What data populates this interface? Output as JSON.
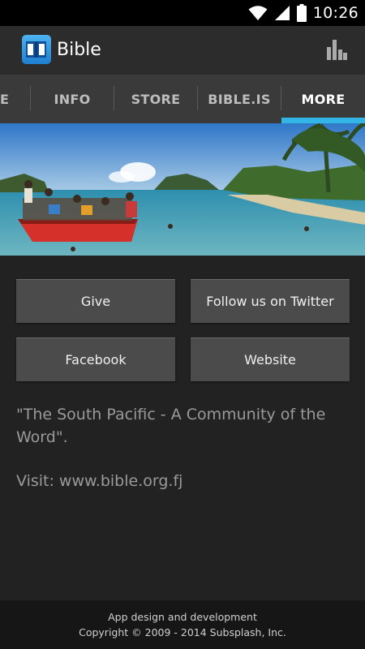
{
  "status_bar": {
    "time": "10:26",
    "icons": [
      "wifi-icon",
      "signal-icon",
      "battery-icon"
    ]
  },
  "action_bar": {
    "title": "Bible",
    "logo_icon": "bible-logo-icon",
    "menu_icon": "stats-icon"
  },
  "tabs": {
    "items": [
      {
        "label": "E"
      },
      {
        "label": "INFO"
      },
      {
        "label": "STORE"
      },
      {
        "label": "BIBLE.IS"
      },
      {
        "label": "MORE"
      }
    ],
    "active": "MORE",
    "accent": "#33b5e5"
  },
  "buttons": {
    "give": "Give",
    "twitter": "Follow us on Twitter",
    "facebook": "Facebook",
    "website": "Website"
  },
  "content": {
    "tagline": "\"The South Pacific - A Community of the Word\".",
    "visit": "Visit: www.bible.org.fj"
  },
  "footer": {
    "line1": "App design and development",
    "line2": "Copyright © 2009 - 2014 Subsplash, Inc."
  }
}
